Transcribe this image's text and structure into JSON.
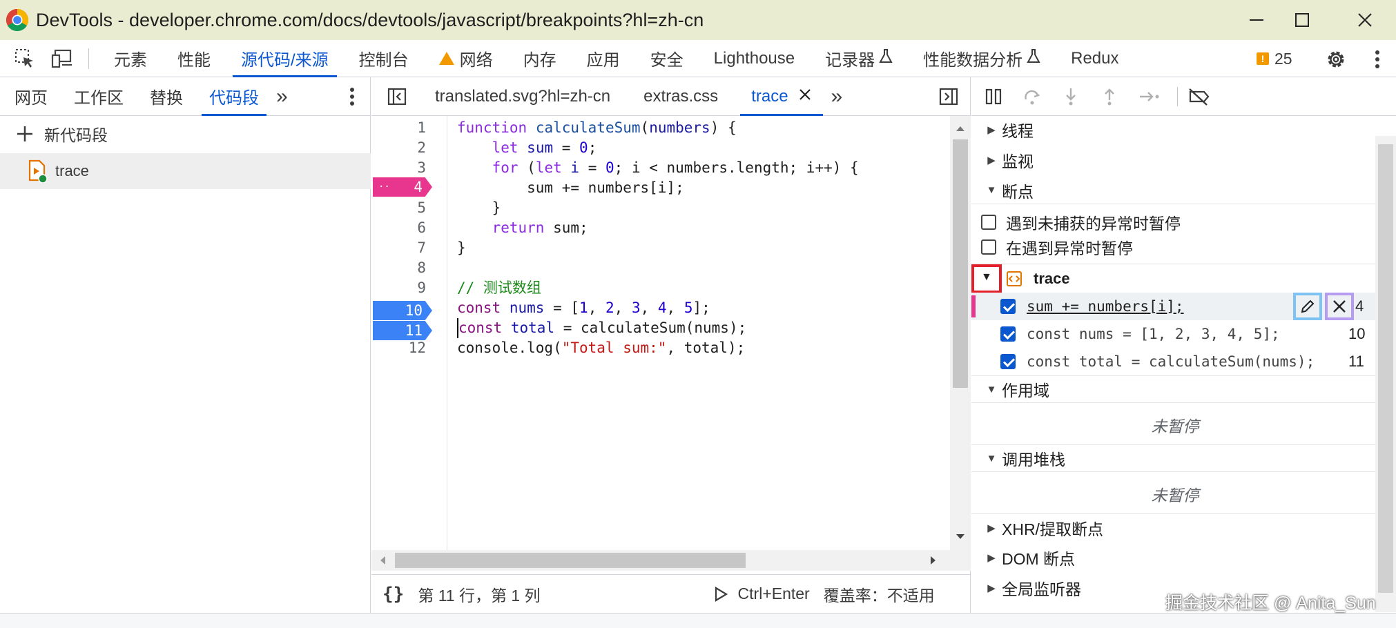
{
  "window": {
    "title": "DevTools - developer.chrome.com/docs/devtools/javascript/breakpoints?hl=zh-cn",
    "minimize": "—",
    "maximize": "☐",
    "close": "✕"
  },
  "main_tabs": [
    {
      "label": "元素"
    },
    {
      "label": "性能"
    },
    {
      "label": "源代码/来源",
      "active": true
    },
    {
      "label": "控制台"
    },
    {
      "label": "网络",
      "warning": true
    },
    {
      "label": "内存"
    },
    {
      "label": "应用"
    },
    {
      "label": "安全"
    },
    {
      "label": "Lighthouse"
    },
    {
      "label": "记录器",
      "flask": true
    },
    {
      "label": "性能数据分析",
      "flask": true
    },
    {
      "label": "Redux"
    }
  ],
  "issues_count": "25",
  "left": {
    "tabs": [
      {
        "label": "网页"
      },
      {
        "label": "工作区"
      },
      {
        "label": "替换"
      },
      {
        "label": "代码段",
        "active": true
      }
    ],
    "more": "»",
    "new_snippet": "新代码段",
    "snippet_name": "trace"
  },
  "editor": {
    "tabs": [
      {
        "label": "translated.svg?hl=zh-cn"
      },
      {
        "label": "extras.css"
      },
      {
        "label": "trace",
        "active": true
      }
    ],
    "line_numbers": [
      "1",
      "2",
      "3",
      "4",
      "5",
      "6",
      "7",
      "8",
      "9",
      "10",
      "11",
      "12"
    ],
    "status": {
      "position": "第 11 行，第 1 列",
      "run": "Ctrl+Enter",
      "coverage": "覆盖率：不适用"
    }
  },
  "right": {
    "sections": {
      "threads": "线程",
      "watch": "监视",
      "breakpoints": "断点",
      "scope": "作用域",
      "call_stack": "调用堆栈",
      "xhr": "XHR/提取断点",
      "dom": "DOM 断点",
      "global": "全局监听器"
    },
    "pause_uncaught": "遇到未捕获的异常时暂停",
    "pause_caught": "在遇到异常时暂停",
    "bp_file": "trace",
    "breakpoints": [
      {
        "code": "sum += numbers[i];",
        "line": "4"
      },
      {
        "code": "const nums = [1, 2, 3, 4, 5];",
        "line": "10"
      },
      {
        "code": "const total = calculateSum(nums);",
        "line": "11"
      }
    ],
    "not_paused": "未暂停",
    "not_paused_2": "未暂停"
  },
  "watermark": "掘金技术社区 @ Anita_Sun",
  "colors": {
    "accent": "#0b57d0",
    "logpoint": "#e8368f",
    "breakpoint": "#3b82f6",
    "titlebar": "#e9ecd0",
    "highlight_red": "#e3202a",
    "highlight_blue": "#7fc3f2",
    "highlight_purple": "#b69cf0"
  }
}
